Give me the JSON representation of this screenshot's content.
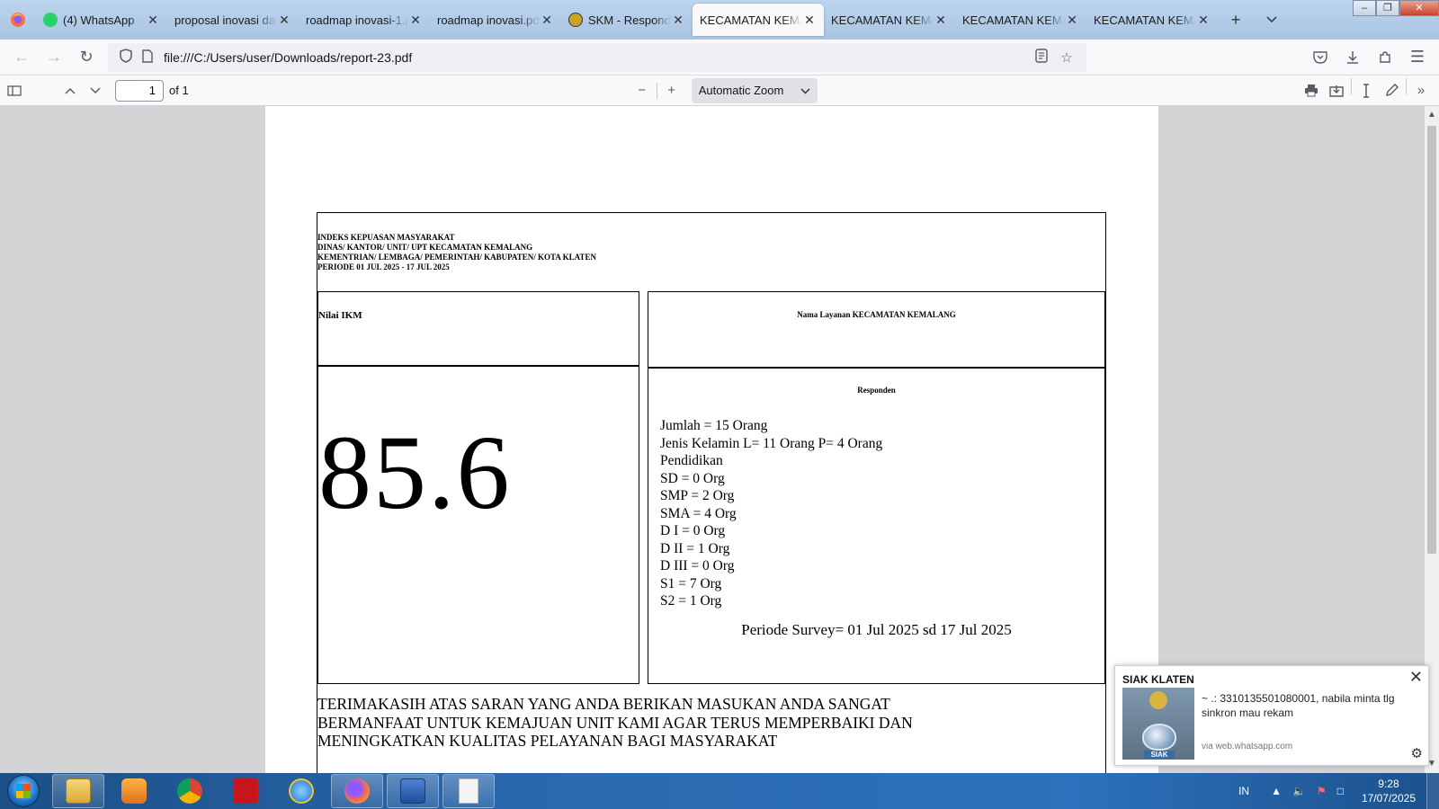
{
  "browser": {
    "tabs": [
      {
        "label": "(4) WhatsApp",
        "icon": "whatsapp-icon",
        "active": false
      },
      {
        "label": "proposal inovasi dae",
        "icon": "",
        "active": false
      },
      {
        "label": "roadmap inovasi-1.p",
        "icon": "",
        "active": false
      },
      {
        "label": "roadmap inovasi.pdf",
        "icon": "",
        "active": false
      },
      {
        "label": "SKM - Responde",
        "icon": "emblem-icon",
        "active": false
      },
      {
        "label": "KECAMATAN KEMAL",
        "icon": "",
        "active": true
      },
      {
        "label": "KECAMATAN KEMAL",
        "icon": "",
        "active": false
      },
      {
        "label": "KECAMATAN KEMAL",
        "icon": "",
        "active": false
      },
      {
        "label": "KECAMATAN KEMAL",
        "icon": "",
        "active": false
      }
    ],
    "url": "file:///C:/Users/user/Downloads/report-23.pdf",
    "accent": "#0060df"
  },
  "pdf_toolbar": {
    "page_number": "1",
    "page_count": "of 1",
    "zoom": "Automatic Zoom"
  },
  "document": {
    "header_lines": [
      "INDEKS KEPUASAN MASYARAKAT",
      "DINAS/ KANTOR/ UNIT/ UPT KECAMATAN KEMALANG",
      "KEMENTRIAN/ LEMBAGA/ PEMERINTAH/ KABUPATEN/ KOTA KLATEN",
      "PERIODE 01 JUL 2025 - 17 JUL 2025"
    ],
    "ikm_label": "Nilai IKM",
    "service_label": "Nama Layanan KECAMATAN KEMALANG",
    "ikm_value": "85.6",
    "respondent_title": "Responden",
    "respondent_lines": [
      "Jumlah = 15 Orang",
      "Jenis Kelamin L= 11 Orang P= 4 Orang",
      "Pendidikan",
      "SD = 0 Org",
      "SMP = 2 Org",
      "SMA = 4 Org",
      "D I = 0 Org",
      "D II = 1 Org",
      "D III = 0 Org",
      "S1 = 7 Org",
      "S2 = 1 Org"
    ],
    "survey_period": "Periode Survey= 01 Jul 2025 sd 17 Jul 2025",
    "thanks_lines": [
      "TERIMAKASIH ATAS SARAN YANG ANDA BERIKAN MASUKAN ANDA SANGAT",
      "BERMANFAAT UNTUK KEMAJUAN UNIT KAMI AGAR TERUS MEMPERBAIKI DAN",
      "MENINGKATKAN KUALITAS PELAYANAN BAGI MASYARAKAT"
    ]
  },
  "notification": {
    "title": "SIAK KLATEN",
    "message": "~ .: 3310135501080001, nabila minta tlg sinkron mau rekam",
    "via": "via web.whatsapp.com",
    "image_label": "SIAK"
  },
  "taskbar": {
    "apps": [
      "explorer",
      "media-player",
      "chrome",
      "acrobat",
      "internet-explorer",
      "firefox",
      "word",
      "blank-document"
    ],
    "language": "IN",
    "time": "9:28",
    "date": "17/07/2025"
  }
}
